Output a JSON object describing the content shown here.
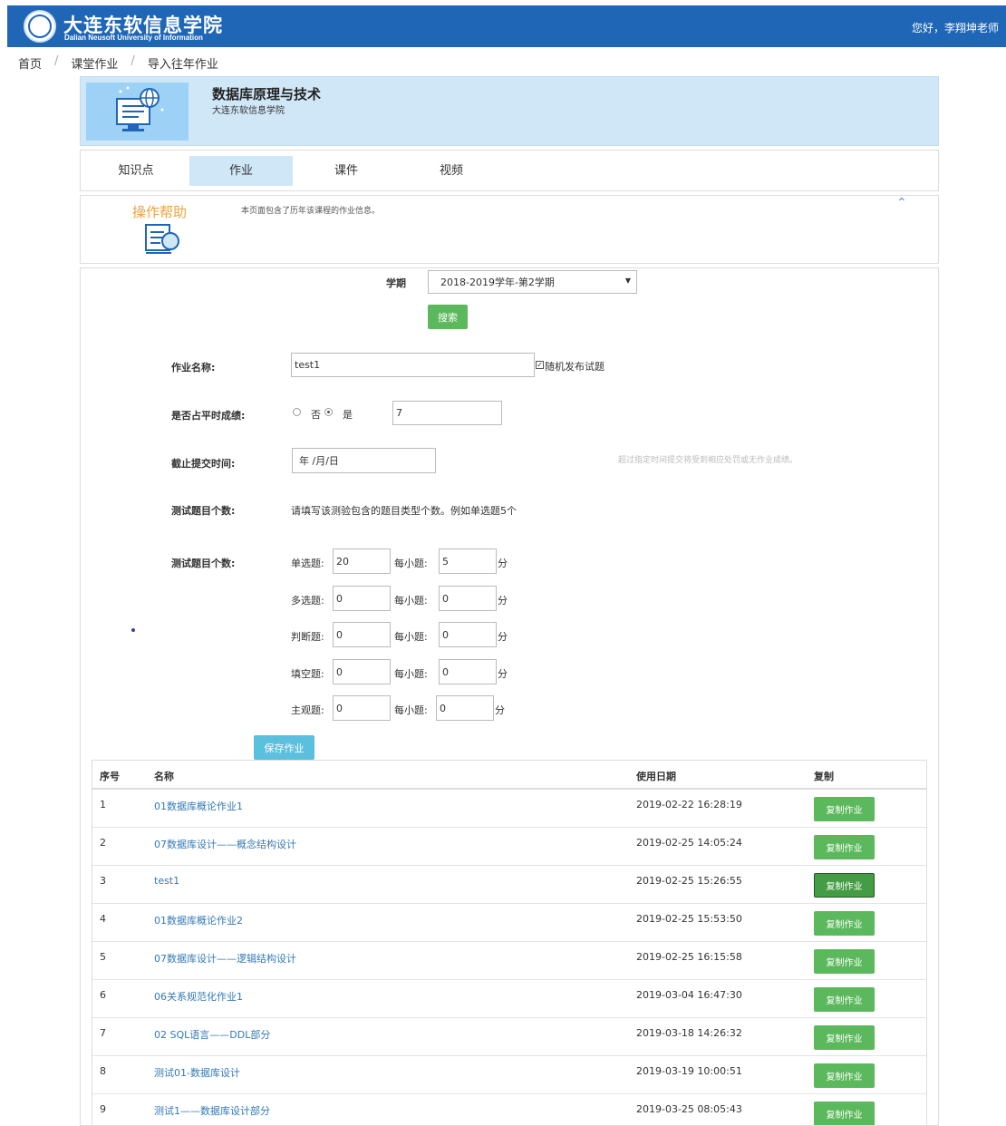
{
  "header": {
    "brand_cn": "大连东软信息学院",
    "brand_en": "Dalian Neusoft University of Information",
    "greeting": "您好，李翔坤老师"
  },
  "breadcrumb": [
    "首页",
    "课堂作业",
    "导入往年作业"
  ],
  "course": {
    "title": "数据库原理与技术",
    "school": "大连东软信息学院"
  },
  "tabs": [
    "知识点",
    "作业",
    "课件",
    "视频"
  ],
  "active_tab": "作业",
  "help": {
    "title": "操作帮助",
    "text": "本页面包含了历年该课程的作业信息。"
  },
  "filter": {
    "term_label": "学期",
    "term_value": "2018-2019学年-第2学期",
    "search_label": "搜索"
  },
  "form": {
    "name_label": "作业名称:",
    "name_value": "test1",
    "random_label": "随机发布试题",
    "random_checked": true,
    "score_label": "是否占平时成绩:",
    "no_label": "否",
    "yes_label": "是",
    "yes_selected": true,
    "score_value": "7",
    "deadline_label": "截止提交时间:",
    "deadline_placeholder": "年 /月/日",
    "deadline_hint": "超过指定时间提交将受到相应处罚或无作业成绩。",
    "count_label": "测试题目个数:",
    "count_hint": "请填写该测验包含的题目类型个数。例如单选题5个",
    "count_label2": "测试题目个数:",
    "per_label": "每小题:",
    "unit": "分",
    "question_types": [
      {
        "label": "单选题:",
        "count": "20",
        "score": "5"
      },
      {
        "label": "多选题:",
        "count": "0",
        "score": "0"
      },
      {
        "label": "判断题:",
        "count": "0",
        "score": "0"
      },
      {
        "label": "填空题:",
        "count": "0",
        "score": "0"
      },
      {
        "label": "主观题:",
        "count": "0",
        "score": "0"
      }
    ],
    "save_label": "保存作业"
  },
  "table": {
    "headers": [
      "序号",
      "名称",
      "使用日期",
      "复制"
    ],
    "copy_label": "复制作业",
    "rows": [
      {
        "no": "1",
        "name": "01数据库概论作业1",
        "date": "2019-02-22 16:28:19"
      },
      {
        "no": "2",
        "name": "07数据库设计——概念结构设计",
        "date": "2019-02-25 14:05:24"
      },
      {
        "no": "3",
        "name": "test1",
        "date": "2019-02-25 15:26:55"
      },
      {
        "no": "4",
        "name": "01数据库概论作业2",
        "date": "2019-02-25 15:53:50"
      },
      {
        "no": "5",
        "name": "07数据库设计——逻辑结构设计",
        "date": "2019-02-25 16:15:58"
      },
      {
        "no": "6",
        "name": "06关系规范化作业1",
        "date": "2019-03-04 16:47:30"
      },
      {
        "no": "7",
        "name": "02 SQL语言——DDL部分",
        "date": "2019-03-18 14:26:32"
      },
      {
        "no": "8",
        "name": "测试01-数据库设计",
        "date": "2019-03-19 10:00:51"
      },
      {
        "no": "9",
        "name": "测试1——数据库设计部分",
        "date": "2019-03-25 08:05:43"
      }
    ],
    "focused_row": 3
  },
  "colors": {
    "header_bg": "#1f66b7",
    "banner_bg": "#d0e7f8",
    "help_title": "#f0a23a",
    "link": "#337ab7",
    "success": "#5cb85c",
    "info": "#5bc0de"
  }
}
